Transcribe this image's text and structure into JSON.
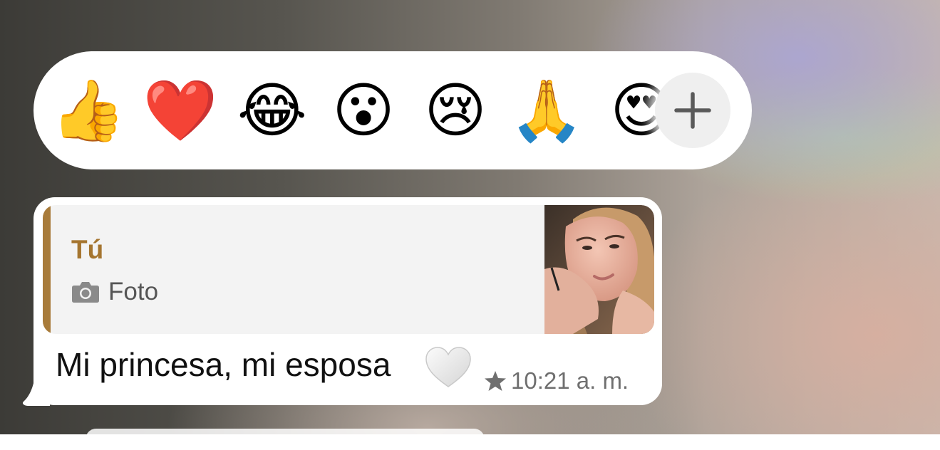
{
  "reactions": {
    "emojis": [
      {
        "name": "thumbs-up",
        "glyph": "👍"
      },
      {
        "name": "red-heart",
        "glyph": "❤️"
      },
      {
        "name": "tears-of-joy",
        "glyph": "😂"
      },
      {
        "name": "surprised",
        "glyph": "😮"
      },
      {
        "name": "crying",
        "glyph": "😢"
      },
      {
        "name": "folded-hands",
        "glyph": "🙏"
      },
      {
        "name": "heart-eyes",
        "glyph": "😍"
      }
    ],
    "more_icon": "plus-icon"
  },
  "message": {
    "quote": {
      "author": "Tú",
      "type_label": "Foto",
      "type_icon": "camera-icon",
      "thumbnail": "photo-thumbnail"
    },
    "text": "Mi princesa, mi esposa",
    "trailing_emoji": "🤍",
    "starred": true,
    "time": "10:21 a. m."
  },
  "colors": {
    "quote_accent": "#a87b3a",
    "quote_author": "#a5752f",
    "bubble": "#ffffff",
    "meta_text": "#6f6f6f"
  }
}
